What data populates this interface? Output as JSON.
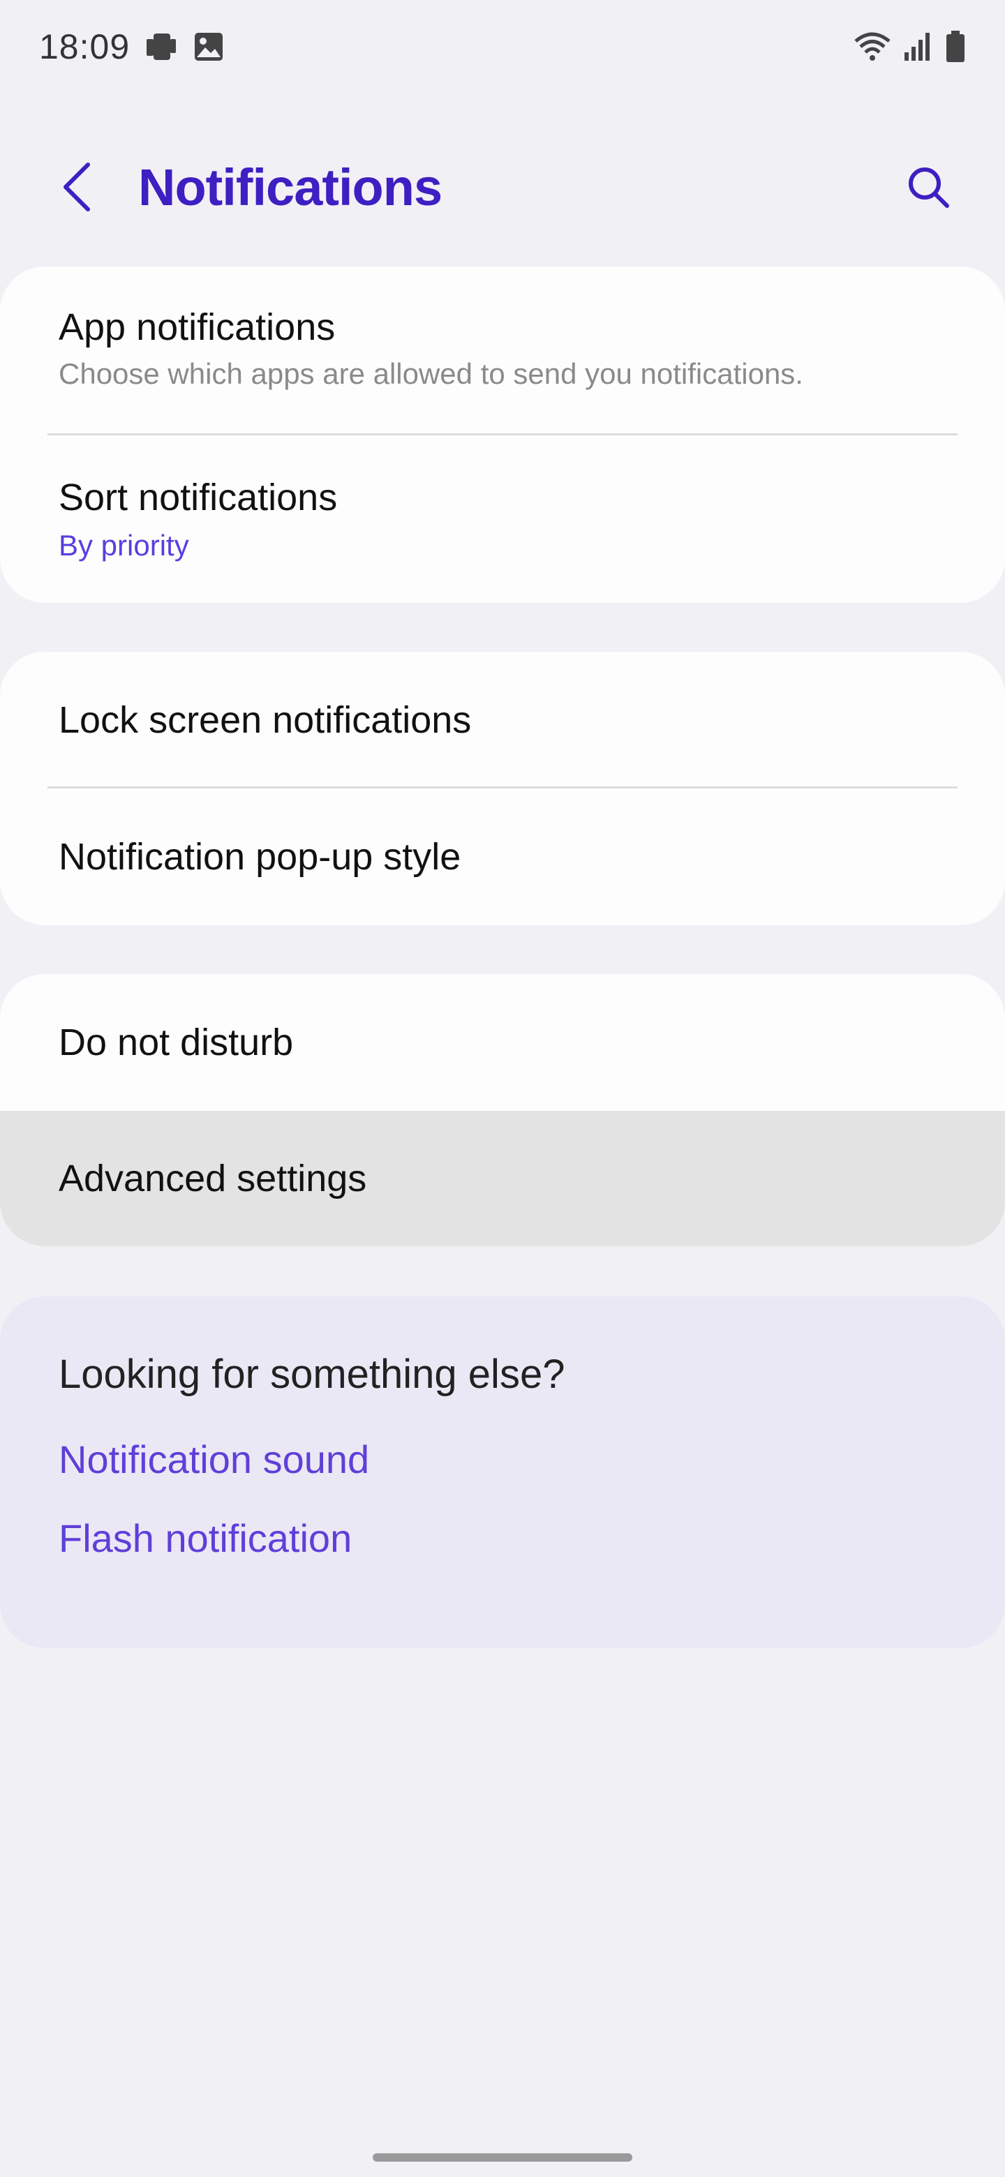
{
  "status_bar": {
    "time": "18:09",
    "left_icons": [
      "device-cast-icon",
      "image-icon"
    ],
    "right_icons": [
      "wifi-icon",
      "signal-icon",
      "battery-icon"
    ]
  },
  "header": {
    "title": "Notifications",
    "back_icon": "chevron-left-icon",
    "search_icon": "search-icon"
  },
  "sections": {
    "general": {
      "app_notifications": {
        "title": "App notifications",
        "subtitle": "Choose which apps are allowed to send you notifications."
      },
      "sort_notifications": {
        "title": "Sort notifications",
        "value": "By priority"
      }
    },
    "display": {
      "lock_screen": {
        "title": "Lock screen notifications"
      },
      "popup_style": {
        "title": "Notification pop-up style"
      }
    },
    "more": {
      "dnd": {
        "title": "Do not disturb"
      },
      "advanced": {
        "title": "Advanced settings"
      }
    }
  },
  "suggestions": {
    "title": "Looking for something else?",
    "links": [
      "Notification sound",
      "Flash notification"
    ]
  },
  "colors": {
    "accent": "#3d1fc2",
    "link": "#5f3fd8",
    "background": "#f1f0f5",
    "card": "#fdfdfd",
    "suggest_card": "#eae8f5",
    "pressed_row": "#e3e3e3"
  }
}
